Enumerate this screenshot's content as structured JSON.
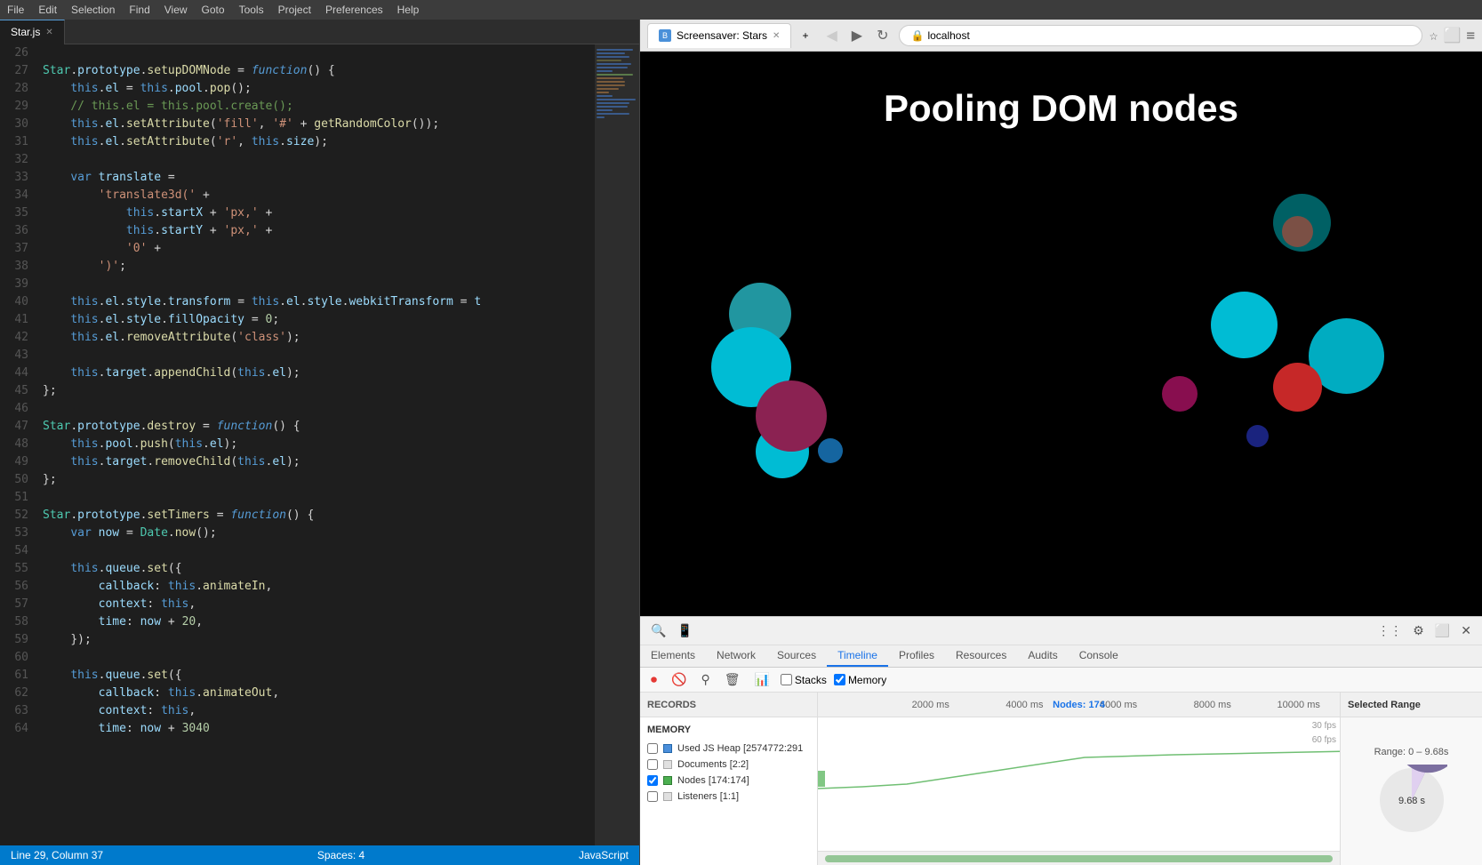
{
  "menu": {
    "items": [
      "File",
      "Edit",
      "Selection",
      "Find",
      "View",
      "Goto",
      "Tools",
      "Project",
      "Preferences",
      "Help"
    ]
  },
  "editor": {
    "tab_label": "Star.js",
    "status_left": "Line 29, Column 37",
    "status_middle": "Spaces: 4",
    "status_right": "JavaScript"
  },
  "browser": {
    "tab_title": "Screensaver: Stars",
    "address": "localhost",
    "page_title": "Pooling DOM nodes"
  },
  "devtools": {
    "tabs": [
      "Elements",
      "Network",
      "Sources",
      "Timeline",
      "Profiles",
      "Resources",
      "Audits",
      "Console"
    ],
    "active_tab": "Timeline",
    "timeline": {
      "toolbar": {
        "stacks_label": "Stacks",
        "memory_label": "Memory"
      },
      "records_label": "RECORDS",
      "memory_label": "MEMORY",
      "nodes_label": "Nodes: 174",
      "scale_labels": [
        "2000 ms",
        "4000 ms",
        "6000 ms",
        "8000 ms",
        "10000 ms"
      ],
      "fps_labels": [
        "30 fps",
        "60 fps"
      ],
      "memory_rows": [
        {
          "color": "#4b8fdb",
          "label": "Used JS Heap [2574772:291"
        },
        {
          "color": "#e0e0e0",
          "label": "Documents [2:2]"
        },
        {
          "color": "#4caf50",
          "label": "Nodes [174:174]"
        },
        {
          "color": "#e0e0e0",
          "label": "Listeners [1:1]"
        }
      ],
      "selected_range": {
        "header": "Selected Range",
        "range_label": "Range: 0 – 9.68s",
        "duration": "9.68 s"
      }
    }
  },
  "code_lines": [
    {
      "num": 26,
      "content": ""
    },
    {
      "num": 27,
      "content": "Star.prototype.setupDOMNode = function() {"
    },
    {
      "num": 28,
      "content": "    this.el = this.pool.pop();"
    },
    {
      "num": 29,
      "content": "    // this.el = this.pool.create();"
    },
    {
      "num": 30,
      "content": "    this.el.setAttribute('fill', '#' + getRandomColor());"
    },
    {
      "num": 31,
      "content": "    this.el.setAttribute('r', this.size);"
    },
    {
      "num": 32,
      "content": ""
    },
    {
      "num": 33,
      "content": "    var translate ="
    },
    {
      "num": 34,
      "content": "        'translate3d(' +"
    },
    {
      "num": 35,
      "content": "            this.startX + 'px,' +"
    },
    {
      "num": 36,
      "content": "            this.startY + 'px,' +"
    },
    {
      "num": 37,
      "content": "            '0' +"
    },
    {
      "num": 38,
      "content": "        ')';"
    },
    {
      "num": 39,
      "content": ""
    },
    {
      "num": 40,
      "content": "    this.el.style.transform = this.el.style.webkitTransform = t"
    },
    {
      "num": 41,
      "content": "    this.el.style.fillOpacity = 0;"
    },
    {
      "num": 42,
      "content": "    this.el.removeAttribute('class');"
    },
    {
      "num": 43,
      "content": ""
    },
    {
      "num": 44,
      "content": "    this.target.appendChild(this.el);"
    },
    {
      "num": 45,
      "content": "};"
    },
    {
      "num": 46,
      "content": ""
    },
    {
      "num": 47,
      "content": "Star.prototype.destroy = function() {"
    },
    {
      "num": 48,
      "content": "    this.pool.push(this.el);"
    },
    {
      "num": 49,
      "content": "    this.target.removeChild(this.el);"
    },
    {
      "num": 50,
      "content": "};"
    },
    {
      "num": 51,
      "content": ""
    },
    {
      "num": 52,
      "content": "Star.prototype.setTimers = function() {"
    },
    {
      "num": 53,
      "content": "    var now = Date.now();"
    },
    {
      "num": 54,
      "content": ""
    },
    {
      "num": 55,
      "content": "    this.queue.set({"
    },
    {
      "num": 56,
      "content": "        callback: this.animateIn,"
    },
    {
      "num": 57,
      "content": "        context: this,"
    },
    {
      "num": 58,
      "content": "        time: now + 20,"
    },
    {
      "num": 59,
      "content": "    });"
    },
    {
      "num": 60,
      "content": ""
    },
    {
      "num": 61,
      "content": "    this.queue.set({"
    },
    {
      "num": 62,
      "content": "        callback: this.animateOut,"
    },
    {
      "num": 63,
      "content": "        context: this,"
    },
    {
      "num": 64,
      "content": "        time: now + 3040"
    }
  ]
}
